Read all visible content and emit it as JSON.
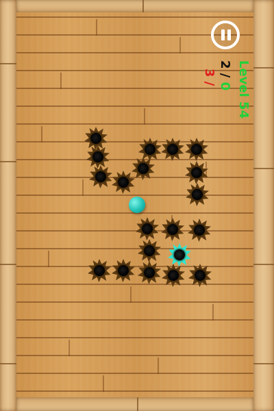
{
  "hud": {
    "level_label": "Level 54",
    "progress_current": "2",
    "progress_sep": " / ",
    "progress_target": "0",
    "lives_current": "3",
    "lives_sep": " / "
  },
  "icons": {
    "pause": "pause-icon"
  },
  "colors": {
    "ball": "#1ec0b3",
    "target_hole": "#2ee6d2",
    "level_text": "#22d13a",
    "lives_text": "#e01f1f"
  }
}
